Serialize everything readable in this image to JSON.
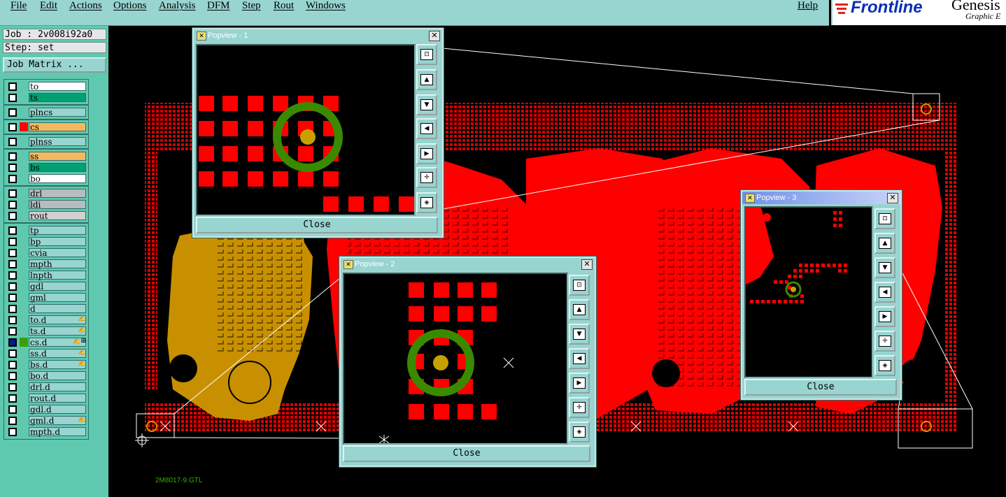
{
  "menu": {
    "items": [
      "File",
      "Edit",
      "Actions",
      "Options",
      "Analysis",
      "DFM",
      "Step",
      "Rout",
      "Windows"
    ],
    "help": "Help"
  },
  "logo": {
    "brand": "Frontline",
    "product": "Genesis",
    "subtitle": "Graphic E"
  },
  "job": {
    "job_label": "Job : 2v008i92a0",
    "step_label": "Step: set",
    "matrix_button": "Job Matrix ..."
  },
  "layers": [
    {
      "name": "to",
      "color": "#ffffff",
      "swatch": ""
    },
    {
      "name": "ts",
      "color": "#00a070",
      "swatch": ""
    },
    {
      "name": "plncs",
      "color": "#98d4d0",
      "swatch": ""
    },
    {
      "name": "cs",
      "color": "#f4b860",
      "swatch": "#ff0000"
    },
    {
      "name": "plnss",
      "color": "#98d4d0",
      "swatch": ""
    },
    {
      "name": "ss",
      "color": "#f4b860",
      "swatch": ""
    },
    {
      "name": "bs",
      "color": "#00a070",
      "swatch": ""
    },
    {
      "name": "bo",
      "color": "#ffffff",
      "swatch": ""
    },
    {
      "name": "drl",
      "color": "#b8bcc0",
      "swatch": ""
    },
    {
      "name": "ldi",
      "color": "#b8bcc0",
      "swatch": ""
    },
    {
      "name": "rout",
      "color": "#d0d0d0",
      "swatch": ""
    },
    {
      "name": "tp",
      "color": "#98d4d0",
      "swatch": ""
    },
    {
      "name": "bp",
      "color": "#98d4d0",
      "swatch": ""
    },
    {
      "name": "cvia",
      "color": "#98d4d0",
      "swatch": ""
    },
    {
      "name": "mpth",
      "color": "#98d4d0",
      "swatch": ""
    },
    {
      "name": "lnpth",
      "color": "#98d4d0",
      "swatch": ""
    },
    {
      "name": "gdl",
      "color": "#98d4d0",
      "swatch": ""
    },
    {
      "name": "gml",
      "color": "#98d4d0",
      "swatch": ""
    },
    {
      "name": "d",
      "color": "#98d4d0",
      "swatch": ""
    },
    {
      "name": "to.d",
      "color": "#98d4d0",
      "swatch": "",
      "icon": "✍"
    },
    {
      "name": "ts.d",
      "color": "#98d4d0",
      "swatch": "",
      "icon": "✍"
    },
    {
      "name": "cs.d",
      "color": "#98d4d0",
      "swatch": "#38a000",
      "icon": "✍⊞",
      "checked": true
    },
    {
      "name": "ss.d",
      "color": "#98d4d0",
      "swatch": "",
      "icon": "✍"
    },
    {
      "name": "bs.d",
      "color": "#98d4d0",
      "swatch": "",
      "icon": "✍"
    },
    {
      "name": "bo.d",
      "color": "#98d4d0",
      "swatch": ""
    },
    {
      "name": "drl.d",
      "color": "#98d4d0",
      "swatch": ""
    },
    {
      "name": "rout.d",
      "color": "#98d4d0",
      "swatch": ""
    },
    {
      "name": "gdl.d",
      "color": "#98d4d0",
      "swatch": ""
    },
    {
      "name": "gml.d",
      "color": "#98d4d0",
      "swatch": "",
      "icon": "✍"
    },
    {
      "name": "mpth.d",
      "color": "#98d4d0",
      "swatch": ""
    }
  ],
  "canvas": {
    "label": "2M8017-9.GTL"
  },
  "popviews": [
    {
      "title": "Popview - 1",
      "close_label": "Close"
    },
    {
      "title": "Popview - 2",
      "close_label": "Close"
    },
    {
      "title": "Popview - 3",
      "close_label": "Close"
    }
  ],
  "popview_tools": [
    "zoom-fit",
    "pan-up",
    "pan-down",
    "pan-left",
    "pan-right",
    "zoom-in",
    "zoom-out"
  ],
  "colors": {
    "pad": "#ff0000",
    "ring": "#3a8a00",
    "ring_center": "#c8a000",
    "board_gold": "#c89000",
    "panel": "#98d4d0"
  }
}
